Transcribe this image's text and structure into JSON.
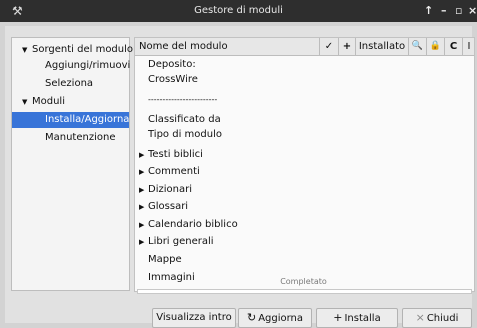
{
  "window": {
    "title": "Gestore di moduli",
    "controls": [
      "↑",
      "–",
      "▫",
      "×"
    ]
  },
  "sidebar": {
    "items": [
      {
        "label": "Sorgenti del modulo",
        "expanded": true
      },
      {
        "label": "Aggiungi/rimuovi"
      },
      {
        "label": "Seleziona"
      },
      {
        "label": "Moduli",
        "expanded": true
      },
      {
        "label": "Installa/Aggiorna",
        "selected": true
      },
      {
        "label": "Manutenzione"
      }
    ]
  },
  "table": {
    "headers": {
      "name": "Nome del modulo",
      "check_icon": "✓",
      "add_icon": "+",
      "installed": "Installato",
      "search_icon": "🔍",
      "lock_icon": "🔒",
      "refresh_icon": "C",
      "info_icon": "I"
    },
    "rows": [
      "Deposito:",
      "CrossWire",
      "------------------------",
      "Classificato da",
      "Tipo di modulo",
      "Testi biblici",
      "Commenti",
      "Dizionari",
      "Glossari",
      "Calendario biblico",
      "Libri generali",
      "Mappe",
      "Immagini"
    ]
  },
  "status": {
    "text": "Completato",
    "progress": 0
  },
  "buttons": {
    "intro": "Visualizza intro",
    "update": "Aggiorna",
    "install": "Installa",
    "close": "Chiudi"
  },
  "icons": {
    "update": "refresh-icon",
    "install": "plus-icon",
    "close": "close-icon"
  }
}
